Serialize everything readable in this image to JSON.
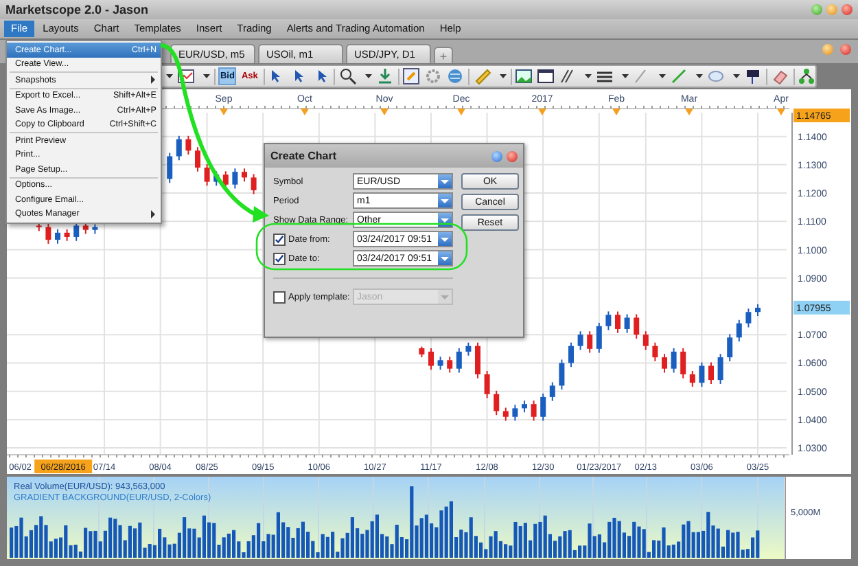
{
  "window": {
    "title": "Marketscope 2.0 - Jason"
  },
  "menu_bar": [
    {
      "label": "File",
      "selected": true
    },
    {
      "label": "Layouts",
      "selected": false
    },
    {
      "label": "Chart",
      "selected": false
    },
    {
      "label": "Templates",
      "selected": false
    },
    {
      "label": "Insert",
      "selected": false
    },
    {
      "label": "Trading",
      "selected": false
    },
    {
      "label": "Alerts and Trading Automation",
      "selected": false
    },
    {
      "label": "Help",
      "selected": false
    }
  ],
  "file_menu": [
    {
      "kind": "item",
      "label": "Create Chart...",
      "shortcut": "Ctrl+N",
      "selected": true
    },
    {
      "kind": "item",
      "label": "Create View...",
      "selected": false
    },
    {
      "kind": "separator"
    },
    {
      "kind": "submenu",
      "label": "Snapshots",
      "selected": false
    },
    {
      "kind": "separator"
    },
    {
      "kind": "item",
      "label": "Export to Excel...",
      "shortcut": "Shift+Alt+E",
      "selected": false
    },
    {
      "kind": "item",
      "label": "Save As Image...",
      "shortcut": "Ctrl+Alt+P",
      "selected": false
    },
    {
      "kind": "item",
      "label": "Copy to Clipboard",
      "shortcut": "Ctrl+Shift+C",
      "selected": false
    },
    {
      "kind": "separator"
    },
    {
      "kind": "item",
      "label": "Print Preview",
      "selected": false
    },
    {
      "kind": "item",
      "label": "Print...",
      "selected": false
    },
    {
      "kind": "item",
      "label": "Page Setup...",
      "selected": false
    },
    {
      "kind": "separator"
    },
    {
      "kind": "item",
      "label": "Options...",
      "selected": false
    },
    {
      "kind": "item",
      "label": "Configure Email...",
      "selected": false
    },
    {
      "kind": "submenu",
      "label": "Quotes Manager",
      "selected": false
    }
  ],
  "chart_tabs": [
    {
      "label": "EUR/USD, m5"
    },
    {
      "label": "USOil, m1"
    },
    {
      "label": "USD/JPY, D1"
    }
  ],
  "new_tab_button": "+",
  "toolbar": {
    "buttons": [
      {
        "label": "Bid",
        "selected": true
      },
      {
        "label": "Ask",
        "selected": false
      }
    ]
  },
  "chart": {
    "chart_data": {
      "type": "candlestick",
      "categories": [
        null,
        "06/02",
        null,
        null,
        null,
        null,
        null,
        null,
        null,
        null,
        "07/14",
        null,
        null,
        null,
        null,
        null,
        "08/04",
        null,
        null,
        null,
        null,
        "08/25",
        null,
        null,
        null,
        null,
        null,
        "09/15",
        null,
        null,
        null,
        null,
        null,
        "10/06",
        null,
        null,
        null,
        null,
        null,
        "10/27",
        null,
        null,
        null,
        null,
        null,
        "11/17",
        null,
        null,
        null,
        null,
        null,
        "12/08",
        null,
        null,
        null,
        null,
        null,
        "12/30",
        null,
        null,
        null,
        null,
        null,
        "01/23/2017",
        null,
        null,
        null,
        null,
        "02/13",
        null,
        null,
        null,
        null,
        null,
        "03/06",
        null,
        null,
        null,
        null,
        null,
        "03/25"
      ],
      "ohlc": [
        null,
        null,
        null,
        [
          1.1085,
          1.1097,
          1.1066,
          1.108
        ],
        [
          1.108,
          1.1092,
          1.1021,
          1.1035
        ],
        [
          1.1035,
          1.1072,
          1.1021,
          1.106
        ],
        [
          1.106,
          1.1072,
          1.1031,
          1.1045
        ],
        [
          1.1045,
          1.1097,
          1.1031,
          1.1085
        ],
        [
          1.1085,
          1.1095,
          1.1056,
          1.107
        ],
        [
          1.107,
          1.109,
          1.1056,
          1.108
        ],
        null,
        null,
        null,
        null,
        null,
        null,
        null,
        [
          1.125,
          1.1342,
          1.1236,
          1.133
        ],
        [
          1.133,
          1.1402,
          1.1316,
          1.139
        ],
        [
          1.139,
          1.1402,
          1.1336,
          1.135
        ],
        [
          1.135,
          1.1362,
          1.1276,
          1.129
        ],
        [
          1.129,
          1.1302,
          1.1226,
          1.124
        ],
        [
          1.124,
          1.1277,
          1.1226,
          1.1265
        ],
        [
          1.1265,
          1.1277,
          1.1216,
          1.123
        ],
        [
          1.123,
          1.1287,
          1.1216,
          1.1275
        ],
        [
          1.1275,
          1.1287,
          1.1241,
          1.1255
        ],
        [
          1.1255,
          1.1267,
          1.1196,
          1.121
        ],
        null,
        null,
        null,
        null,
        null,
        null,
        null,
        null,
        null,
        null,
        null,
        null,
        null,
        null,
        null,
        null,
        null,
        [
          1.0652,
          1.0658,
          1.062,
          1.063
        ],
        [
          1.064,
          1.0652,
          1.0576,
          1.059
        ],
        [
          1.059,
          1.0622,
          1.0576,
          1.061
        ],
        [
          1.061,
          1.0622,
          1.0566,
          1.058
        ],
        [
          1.058,
          1.0652,
          1.0566,
          1.064
        ],
        [
          1.064,
          1.0672,
          1.0626,
          1.066
        ],
        [
          1.066,
          1.0672,
          1.0546,
          1.056
        ],
        [
          1.056,
          1.0572,
          1.0476,
          1.049
        ],
        [
          1.049,
          1.0502,
          1.0416,
          1.043
        ],
        [
          1.043,
          1.0442,
          1.0396,
          1.041
        ],
        [
          1.041,
          1.0452,
          1.0396,
          1.044
        ],
        [
          1.044,
          1.0467,
          1.0426,
          1.0455
        ],
        [
          1.0455,
          1.0467,
          1.0396,
          1.041
        ],
        [
          1.041,
          1.0492,
          1.0396,
          1.048
        ],
        [
          1.048,
          1.0532,
          1.0466,
          1.052
        ],
        [
          1.052,
          1.0612,
          1.0506,
          1.06
        ],
        [
          1.06,
          1.0672,
          1.0586,
          1.066
        ],
        [
          1.066,
          1.0712,
          1.0646,
          1.07
        ],
        [
          1.07,
          1.0712,
          1.0636,
          1.065
        ],
        [
          1.065,
          1.0742,
          1.0636,
          1.073
        ],
        [
          1.073,
          1.0782,
          1.0716,
          1.077
        ],
        [
          1.077,
          1.0782,
          1.0706,
          1.072
        ],
        [
          1.072,
          1.0772,
          1.0706,
          1.076
        ],
        [
          1.076,
          1.0772,
          1.0686,
          1.07
        ],
        [
          1.07,
          1.0712,
          1.0646,
          1.066
        ],
        [
          1.066,
          1.0672,
          1.0606,
          1.062
        ],
        [
          1.062,
          1.0632,
          1.0566,
          1.058
        ],
        [
          1.058,
          1.0652,
          1.0566,
          1.064
        ],
        [
          1.064,
          1.0652,
          1.0546,
          1.056
        ],
        [
          1.056,
          1.0572,
          1.0516,
          1.053
        ],
        [
          1.053,
          1.0602,
          1.0516,
          1.059
        ],
        [
          1.059,
          1.0602,
          1.0526,
          1.054
        ],
        [
          1.054,
          1.0632,
          1.0526,
          1.062
        ],
        [
          1.062,
          1.0702,
          1.0606,
          1.069
        ],
        [
          1.069,
          1.0752,
          1.0676,
          1.074
        ],
        [
          1.074,
          1.0792,
          1.0726,
          1.078
        ],
        [
          1.078,
          1.0807,
          1.0766,
          1.0795
        ]
      ],
      "ylim": [
        1.0276,
        1.1484
      ],
      "grid": true,
      "yticks": [
        {
          "value": 1.14,
          "label": "1.1400"
        },
        {
          "value": 1.13,
          "label": "1.1300"
        },
        {
          "value": 1.12,
          "label": "1.1200"
        },
        {
          "value": 1.11,
          "label": "1.1100"
        },
        {
          "value": 1.1,
          "label": "1.1000"
        },
        {
          "value": 1.09,
          "label": "1.0900"
        },
        {
          "value": 1.07,
          "label": "1.0700"
        },
        {
          "value": 1.06,
          "label": "1.0600"
        },
        {
          "value": 1.05,
          "label": "1.0500"
        },
        {
          "value": 1.04,
          "label": "1.0400"
        },
        {
          "value": 1.03,
          "label": "1.0300"
        }
      ]
    },
    "cursor_date_tag": "06/28/2016",
    "month_labels": [
      "Sep",
      "Oct",
      "Nov",
      "Dec",
      "2017",
      "Feb",
      "Mar",
      "Apr"
    ],
    "high_price_tag": "1.14765",
    "current_price_tag": "1.07955"
  },
  "volume": {
    "title": "Real Volume(EUR/USD): 943,563,000",
    "background_label": "GRADIENT BACKGROUND(EUR/USD, 2-Colors)",
    "axis_label": "5,000M"
  },
  "dialog": {
    "title": "Create Chart",
    "fields": [
      {
        "kind": "dropdown",
        "label": "Symbol",
        "value": "EUR/USD",
        "disabled": false
      },
      {
        "kind": "dropdown",
        "label": "Period",
        "value": "m1",
        "disabled": false
      },
      {
        "kind": "dropdown",
        "label": "Show Data Range:",
        "value": "Other",
        "disabled": false
      },
      {
        "kind": "check-dropdown",
        "label": "Date from:",
        "value": "03/24/2017 09:51",
        "checked": true,
        "disabled": false
      },
      {
        "kind": "check-dropdown",
        "label": "Date to:",
        "value": "03/24/2017 09:51",
        "checked": true,
        "disabled": false
      },
      {
        "kind": "check-dropdown",
        "label": "Apply template:",
        "value": "Jason",
        "checked": false,
        "disabled": true
      }
    ],
    "buttons": [
      "OK",
      "Cancel",
      "Reset"
    ]
  }
}
